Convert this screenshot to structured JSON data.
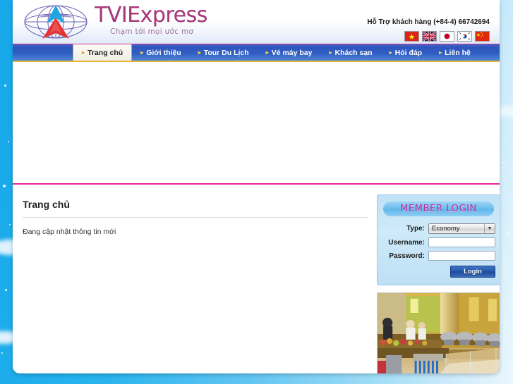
{
  "site": {
    "brand": "TVIExpress",
    "brand_prefix": "T",
    "slogan": "Chạm tới mọi ước mơ",
    "logo_icon": "globe-arrow-logo-icon"
  },
  "header": {
    "support_text": "Hỗ Trợ khách hàng (+84-4) 66742694",
    "languages": [
      {
        "name": "vietnam-flag-icon",
        "label": "Tiếng Việt"
      },
      {
        "name": "uk-flag-icon",
        "label": "English"
      },
      {
        "name": "japan-flag-icon",
        "label": "日本語"
      },
      {
        "name": "korea-flag-icon",
        "label": "한국어"
      },
      {
        "name": "china-flag-icon",
        "label": "中文"
      }
    ]
  },
  "nav": {
    "items": [
      {
        "label": "Trang chủ",
        "active": true
      },
      {
        "label": "Giới thiệu",
        "active": false
      },
      {
        "label": "Tour Du Lịch",
        "active": false
      },
      {
        "label": "Vé máy bay",
        "active": false
      },
      {
        "label": "Khách sạn",
        "active": false
      },
      {
        "label": "Hỏi đáp",
        "active": false
      },
      {
        "label": "Liên hệ",
        "active": false
      }
    ]
  },
  "main": {
    "title": "Trang chủ",
    "body": "Đang cập nhật thông tin mới"
  },
  "login": {
    "title": "MEMBER LOGIN",
    "type_label": "Type:",
    "type_value": "Economy",
    "type_options": [
      "Economy"
    ],
    "username_label": "Username:",
    "username_value": "",
    "password_label": "Password:",
    "password_value": "",
    "submit_label": "Login"
  },
  "sidebar_photo": {
    "alt": "buffet-restaurant-photo"
  },
  "colors": {
    "nav_blue": "#2f55bd",
    "accent_pink": "#e6259b",
    "accent_gold": "#e8b53b",
    "brand_magenta": "#a63a7b",
    "login_title": "#c3279a",
    "sky_blue": "#29b4ee"
  }
}
